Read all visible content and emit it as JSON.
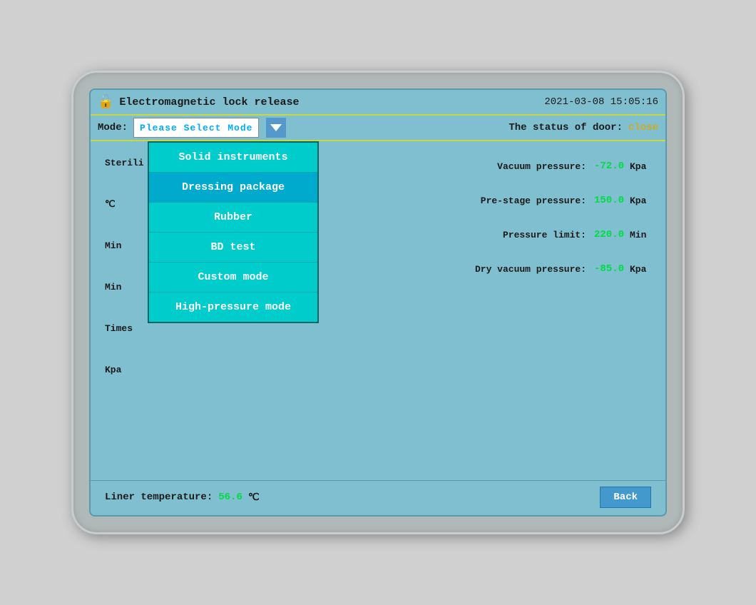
{
  "titleBar": {
    "lockIcon": "🔓",
    "title": "Electromagnetic lock release",
    "datetime": "2021-03-08  15:05:16"
  },
  "modeBar": {
    "modeLabel": "Mode:",
    "selectPlaceholder": "Please Select Mode",
    "doorStatusLabel": "The status of door:",
    "doorStatusValue": "close"
  },
  "dropdown": {
    "items": [
      "Solid instruments",
      "Dressing  package",
      "Rubber",
      "BD test",
      "Custom mode",
      "High-pressure mode"
    ]
  },
  "parameters": {
    "vacuumPressure": {
      "label": "Vacuum pressure:",
      "value": "-72.0",
      "unit": "Kpa"
    },
    "preStage": {
      "label": "Pre-stage pressure:",
      "value": "150.0",
      "unit": "Kpa"
    },
    "pressureLimit": {
      "label": "Pressure limit:",
      "value": "220.0",
      "unit": "Min"
    },
    "dryVacuum": {
      "label": "Dry vacuum pressure:",
      "value": "-85.0",
      "unit": "Kpa"
    }
  },
  "partialLabels": {
    "sterilization": "Sterili",
    "unitC": "℃",
    "unitMin1": "Min",
    "unitMin2": "Min",
    "unitTimes": "Times",
    "unitKpa": "Kpa"
  },
  "linerTemp": {
    "label": "Liner temperature:",
    "value": "56.6",
    "unit": "℃"
  },
  "backButton": "Back"
}
